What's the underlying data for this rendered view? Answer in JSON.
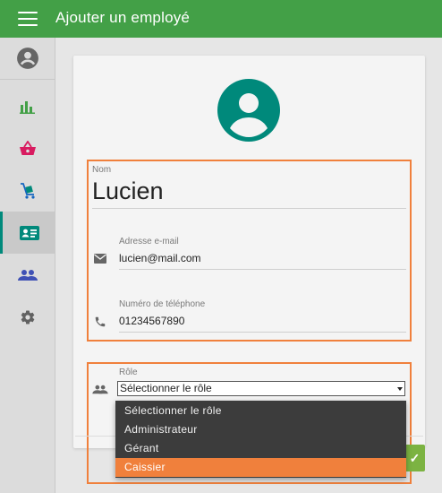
{
  "colors": {
    "primary": "#43a047",
    "accent": "#00897b",
    "highlight": "#f0803c",
    "danger": "#d81b60"
  },
  "topbar": {
    "title": "Ajouter un employé",
    "menu_icon": "menu-icon"
  },
  "sidebar": {
    "items": [
      {
        "name": "profile",
        "icon": "account-circle-icon"
      },
      {
        "name": "stats",
        "icon": "bar-chart-icon"
      },
      {
        "name": "basket",
        "icon": "basket-icon"
      },
      {
        "name": "cart",
        "icon": "cart-icon"
      },
      {
        "name": "employees-card",
        "icon": "id-card-icon",
        "active": true
      },
      {
        "name": "people",
        "icon": "people-icon"
      },
      {
        "name": "settings",
        "icon": "gear-icon"
      }
    ]
  },
  "form": {
    "name_label": "Nom",
    "name_value": "Lucien",
    "email_label": "Adresse e-mail",
    "email_value": "lucien@mail.com",
    "phone_label": "Numéro de téléphone",
    "phone_value": "01234567890",
    "role_label": "Rôle",
    "role_selected": "Sélectionner le rôle",
    "role_options": [
      "Sélectionner le rôle",
      "Administrateur",
      "Gérant",
      "Caissier"
    ],
    "role_highlighted": "Caissier"
  },
  "fab": {
    "label": "✓"
  }
}
